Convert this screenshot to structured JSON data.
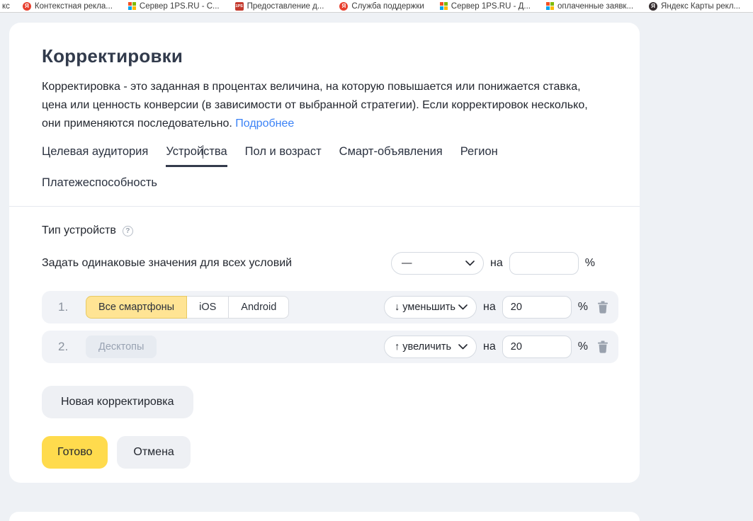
{
  "bookmarks_bar": {
    "ya_glyph": "Я",
    "ps_glyph": "1PS",
    "items": [
      {
        "label": "кс",
        "icon": "none"
      },
      {
        "label": "Контекстная рекла...",
        "icon": "yandex-icon"
      },
      {
        "label": "Сервер 1PS.RU - С...",
        "icon": "windows-icon"
      },
      {
        "label": "Предоставление д...",
        "icon": "1ps-icon"
      },
      {
        "label": "Служба поддержки",
        "icon": "yandex-icon"
      },
      {
        "label": "Сервер 1PS.RU - Д...",
        "icon": "windows-icon"
      },
      {
        "label": "оплаченные заявк...",
        "icon": "windows-icon"
      },
      {
        "label": "Яндекс Карты рекл...",
        "icon": "yandex-dark-icon"
      }
    ]
  },
  "dialog": {
    "title": "Корректировки",
    "description": "Корректировка - это заданная в процентах величина, на которую повышается или понижается ставка, цена или ценность конверсии (в зависимости от выбранной стратегии). Если корректировок несколько, они применяются последовательно.",
    "more_link": "Подробнее",
    "tabs": [
      {
        "label": "Целевая аудитория",
        "active": false
      },
      {
        "label": "Устройства",
        "active": true
      },
      {
        "label": "Пол и возраст",
        "active": false
      },
      {
        "label": "Смарт-объявления",
        "active": false
      },
      {
        "label": "Регион",
        "active": false
      },
      {
        "label": "Платежеспособность",
        "active": false
      }
    ],
    "device_type": {
      "label": "Тип устройств",
      "help_glyph": "?"
    },
    "bulk": {
      "label": "Задать одинаковые значения для всех условий",
      "select_value": "—",
      "na": "на",
      "input_value": "",
      "percent": "%"
    },
    "rows": [
      {
        "index": "1.",
        "segments": [
          "Все смартфоны",
          "iOS",
          "Android"
        ],
        "selected_segment": "Все смартфоны",
        "action": "↓ уменьшить",
        "na": "на",
        "value": "20",
        "percent": "%"
      },
      {
        "index": "2.",
        "condition": "Десктопы",
        "action": "↑ увеличить",
        "na": "на",
        "value": "20",
        "percent": "%"
      }
    ],
    "buttons": {
      "new_adjustment": "Новая корректировка",
      "done": "Готово",
      "cancel": "Отмена"
    }
  },
  "colors": {
    "page_bg": "#eef1f5",
    "accent_yellow": "#ffdb4d",
    "selected_segment_yellow": "#ffe494",
    "link_blue": "#3b82f6",
    "row_bg": "#f1f3f7",
    "active_tab_underline": "#343b4c"
  }
}
